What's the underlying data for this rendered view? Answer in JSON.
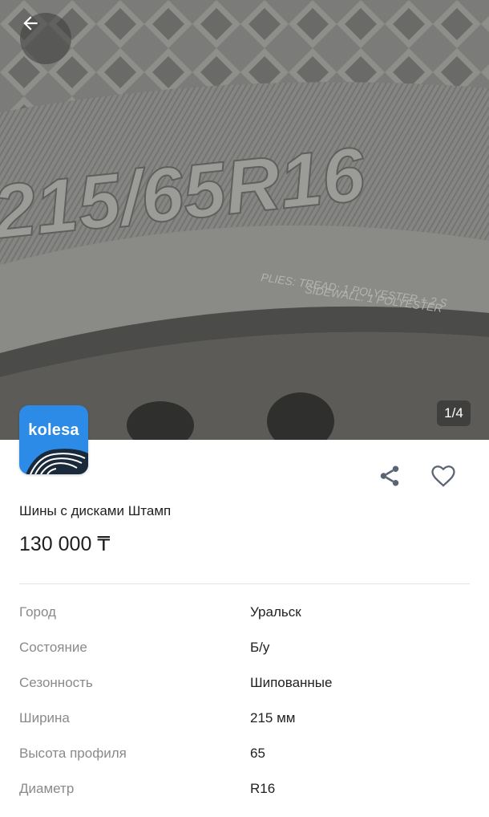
{
  "gallery": {
    "counter": "1/4",
    "tire_marking": "215/65R16",
    "sidewall_line1": "PLIES: TREAD: 1 POLYESTER + 2 S",
    "sidewall_line2": "SIDEWALL: 1 POLYESTER"
  },
  "brand": {
    "logo_text": "kolesa",
    "logo_color": "#2d8be8"
  },
  "actions": {
    "back_icon": "arrow-left-icon",
    "share_icon": "share-icon",
    "favorite_icon": "heart-icon"
  },
  "listing": {
    "title": "Шины с дисками Штамп",
    "price": "130 000 ₸"
  },
  "specs": [
    {
      "label": "Город",
      "value": "Уральск"
    },
    {
      "label": "Состояние",
      "value": "Б/у"
    },
    {
      "label": "Сезонность",
      "value": "Шипованные"
    },
    {
      "label": "Ширина",
      "value": "215 мм"
    },
    {
      "label": "Высота профиля",
      "value": "65"
    },
    {
      "label": "Диаметр",
      "value": "R16"
    }
  ]
}
